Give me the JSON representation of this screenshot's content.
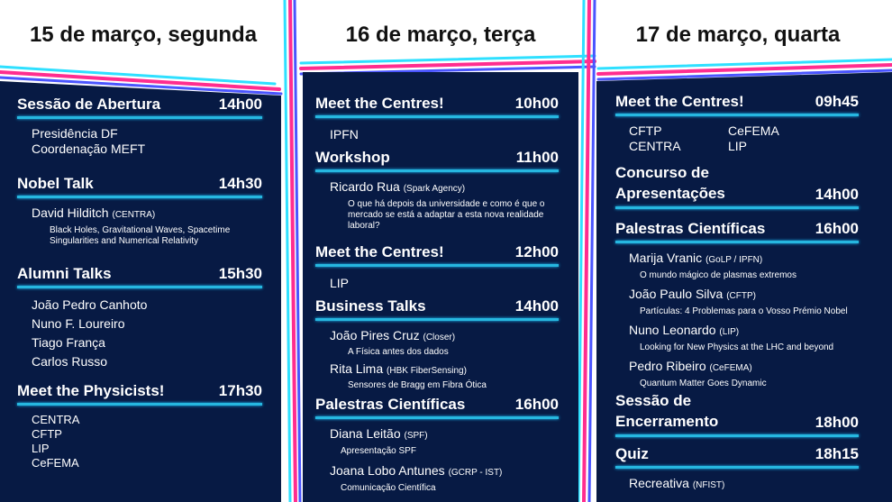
{
  "days": [
    {
      "header": "15 de março, segunda",
      "sections": [
        {
          "title": "Sessão de Abertura",
          "time": "14h00",
          "lines": [
            "Presidência DF",
            "Coordenação MEFT"
          ]
        },
        {
          "title": "Nobel Talk",
          "time": "14h30",
          "speaker": "David Hilditch",
          "aff": "(CENTRA)",
          "desc": "Black Holes, Gravitational Waves, Spacetime Singularities and Numerical Relativity"
        },
        {
          "title": "Alumni Talks",
          "time": "15h30",
          "lines": [
            "João Pedro Canhoto",
            "Nuno F. Loureiro",
            "Tiago França",
            "Carlos Russo"
          ]
        },
        {
          "title": "Meet the Physicists!",
          "time": "17h30",
          "lines": [
            "CENTRA",
            "CFTP",
            "LIP",
            "CeFEMA"
          ]
        }
      ]
    },
    {
      "header": "16 de março, terça",
      "sections": [
        {
          "title": "Meet the Centres!",
          "time": "10h00",
          "lines": [
            "IPFN"
          ]
        },
        {
          "title": "Workshop",
          "time": "11h00",
          "speaker": "Ricardo Rua",
          "aff": "(Spark Agency)",
          "desc": "O que há depois da universidade e como é que o mercado se está a adaptar a esta nova realidade laboral?"
        },
        {
          "title": "Meet the Centres!",
          "time": "12h00",
          "lines": [
            "LIP"
          ]
        },
        {
          "title": "Business Talks",
          "time": "14h00",
          "talks": [
            {
              "speaker": "João Pires Cruz",
              "aff": "(Closer)",
              "desc": "A Física antes dos dados"
            },
            {
              "speaker": "Rita Lima",
              "aff": "(HBK FiberSensing)",
              "desc": "Sensores de Bragg em Fibra Ótica"
            }
          ]
        },
        {
          "title": "Palestras Científicas",
          "time": "16h00",
          "talks": [
            {
              "speaker": "Diana Leitão",
              "aff": "(SPF)",
              "desc": "Apresentação SPF"
            },
            {
              "speaker": "Joana Lobo Antunes",
              "aff": "(GCRP - IST)",
              "desc": "Comunicação Científica"
            }
          ]
        }
      ]
    },
    {
      "header": "17 de março, quarta",
      "sections": [
        {
          "title": "Meet the Centres!",
          "time": "09h45",
          "grid": [
            "CFTP",
            "CeFEMA",
            "CENTRA",
            "LIP"
          ]
        },
        {
          "title": "Concurso de\nApresentações",
          "time": "14h00"
        },
        {
          "title": "Palestras Científicas",
          "time": "16h00",
          "talks": [
            {
              "speaker": "Marija Vranic",
              "aff": "(GoLP / IPFN)",
              "desc": "O mundo mágico de plasmas extremos"
            },
            {
              "speaker": "João Paulo Silva",
              "aff": "(CFTP)",
              "desc": "Partículas: 4 Problemas para o Vosso Prémio Nobel"
            },
            {
              "speaker": "Nuno Leonardo",
              "aff": "(LIP)",
              "desc": "Looking for New Physics at the LHC and beyond"
            },
            {
              "speaker": "Pedro Ribeiro",
              "aff": "(CeFEMA)",
              "desc": "Quantum Matter Goes Dynamic"
            }
          ]
        },
        {
          "title": "Sessão de\nEncerramento",
          "time": "18h00"
        },
        {
          "title": "Quiz",
          "time": "18h15",
          "speaker": "Recreativa",
          "aff": "(NFIST)"
        }
      ]
    }
  ],
  "colors": {
    "panel": "#071a44",
    "rule": "#26b7e0",
    "pink": "#ff2d8f",
    "cyan": "#2fe0ff",
    "blue": "#1d3cff"
  }
}
